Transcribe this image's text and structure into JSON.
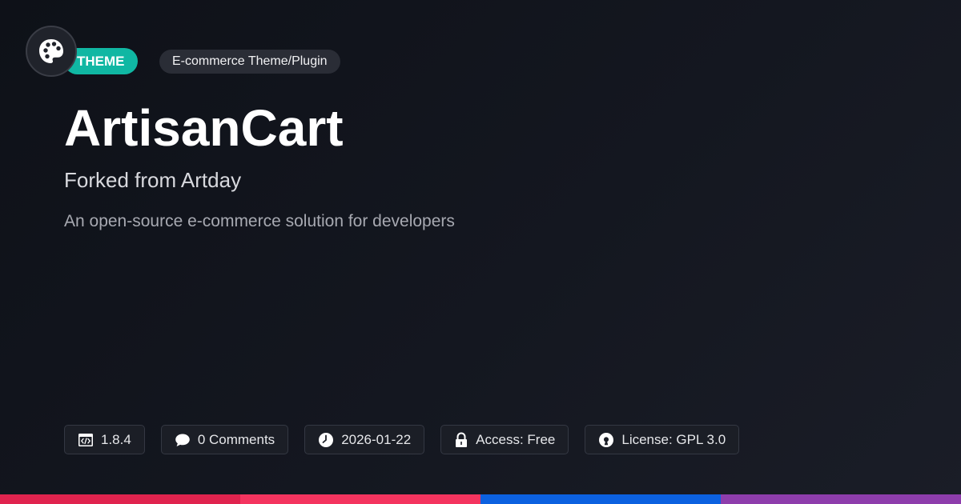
{
  "header": {
    "logo_icon": "palette-icon",
    "type_badge": "THEME",
    "category_badge": "E-commerce Theme/Plugin"
  },
  "main": {
    "title": "ArtisanCart",
    "subtitle": "Forked from Artday",
    "description": "An open-source e-commerce solution for developers"
  },
  "meta": {
    "version": {
      "icon": "code-window-icon",
      "label": "1.8.4"
    },
    "comments": {
      "icon": "comment-bubble-icon",
      "label": "0 Comments"
    },
    "date": {
      "icon": "clock-icon",
      "label": "2026-01-22"
    },
    "access": {
      "icon": "lock-icon",
      "label": "Access: Free"
    },
    "license": {
      "icon": "open-source-icon",
      "label": "License: GPL 3.0"
    }
  },
  "colors": {
    "accent_teal": "#10b7a3",
    "stripe": [
      "#e0234e",
      "#f4345f",
      "#0c61e0",
      "#8e3dac"
    ]
  }
}
